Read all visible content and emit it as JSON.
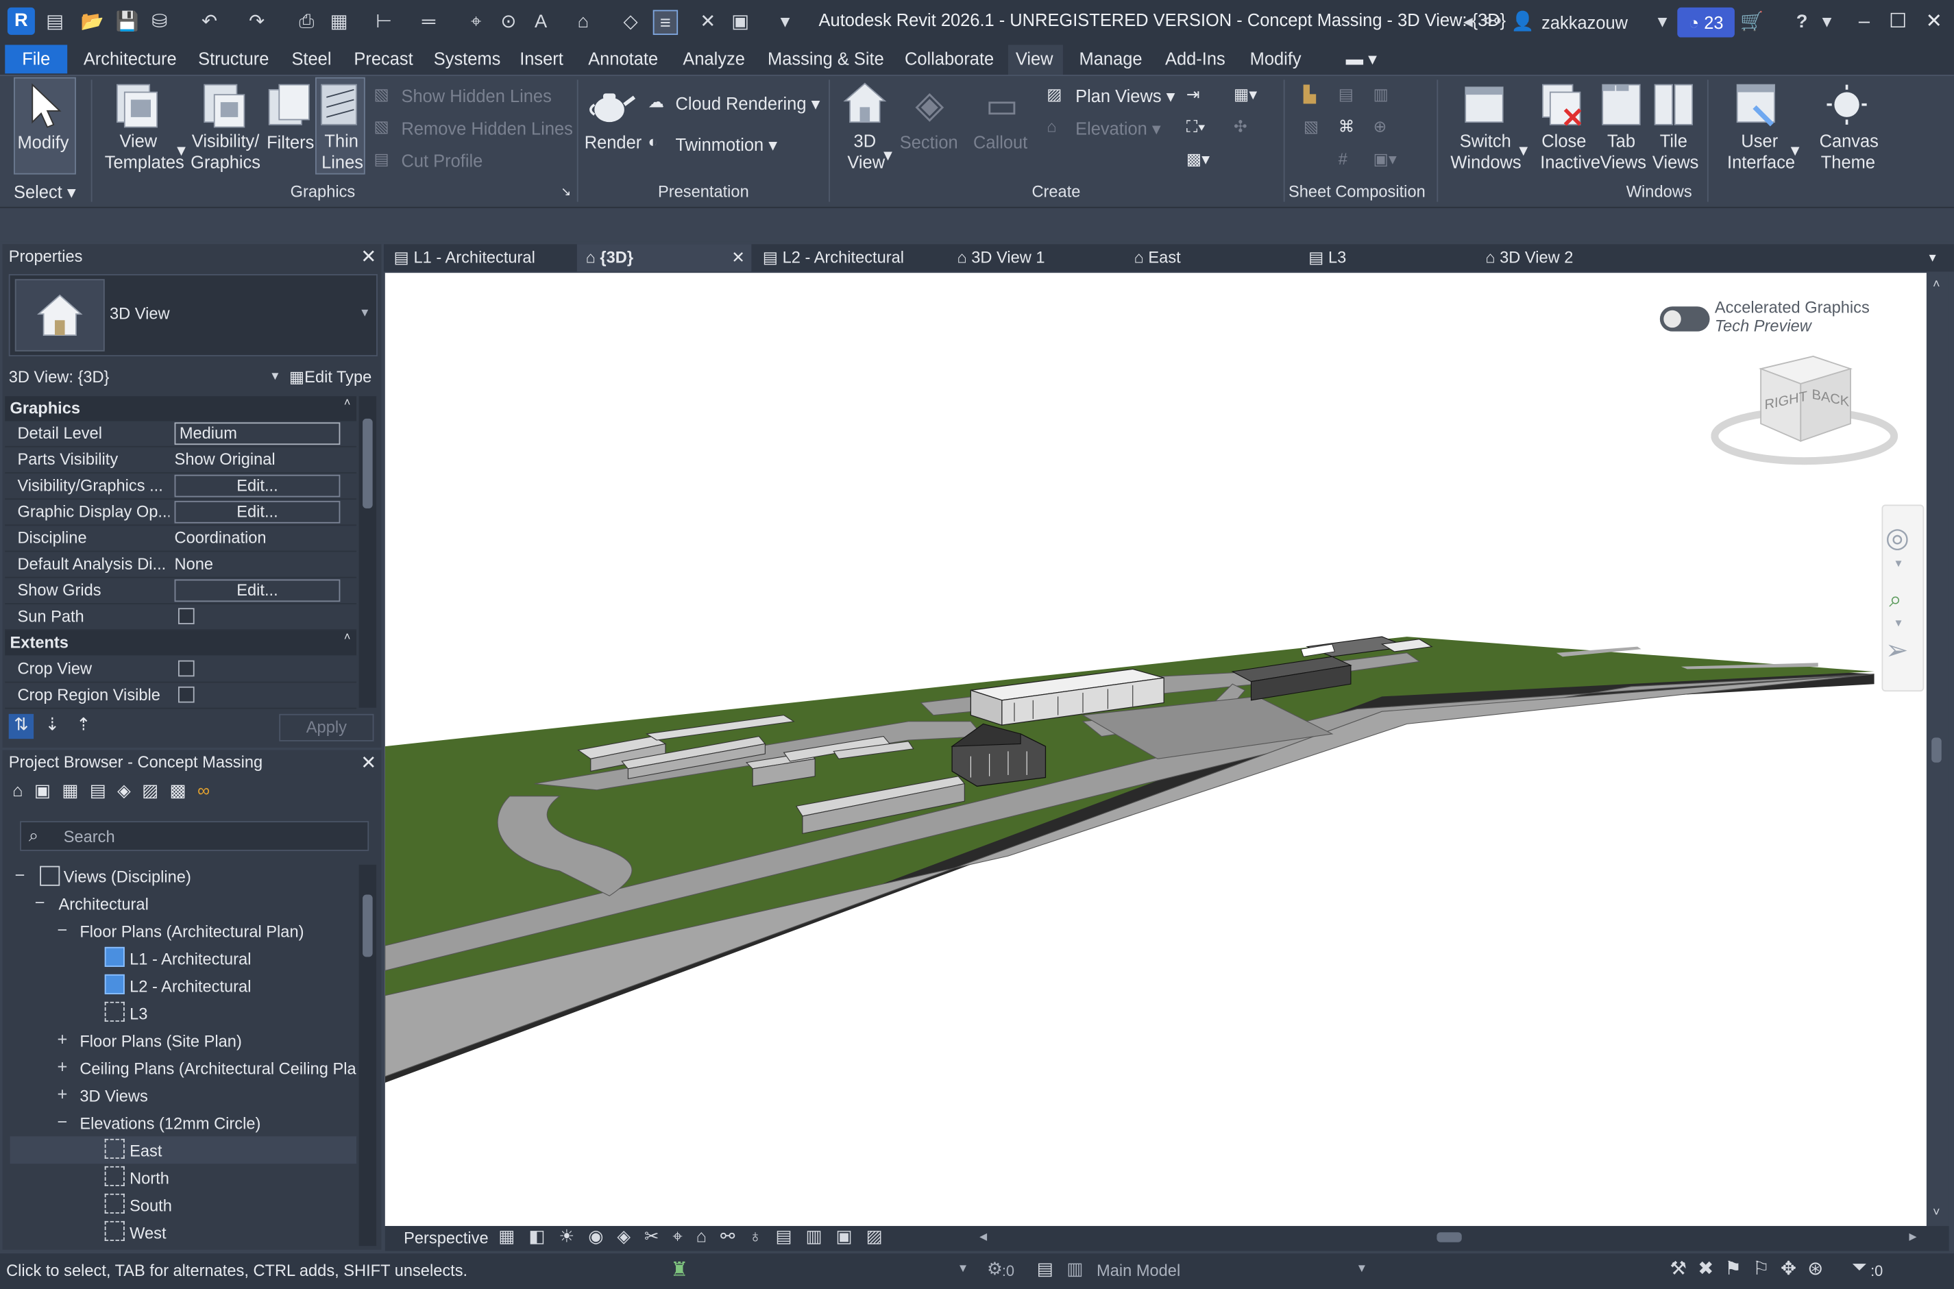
{
  "titlebar": {
    "title": "Autodesk Revit 2026.1 - UNREGISTERED VERSION - Concept Massing - 3D View: {3D}",
    "logo": "R",
    "user": "zakkazouw",
    "trial_count": "23"
  },
  "menu": {
    "file": "File",
    "items": [
      "Architecture",
      "Structure",
      "Steel",
      "Precast",
      "Systems",
      "Insert",
      "Annotate",
      "Analyze",
      "Massing & Site",
      "Collaborate",
      "View",
      "Manage",
      "Add-Ins",
      "Modify"
    ],
    "active": "View"
  },
  "ribbon": {
    "modify": "Modify",
    "select": "Select",
    "view_templates": [
      "View",
      "Templates"
    ],
    "vis_graphics": [
      "Visibility/",
      "Graphics"
    ],
    "filters": "Filters",
    "thin_lines": [
      "Thin",
      "Lines"
    ],
    "show_hidden": "Show  Hidden Lines",
    "remove_hidden": "Remove  Hidden Lines",
    "cut_profile": "Cut  Profile",
    "graphics_panel": "Graphics",
    "render": "Render",
    "cloud_rendering": "Cloud  Rendering",
    "twinmotion": "Twinmotion",
    "presentation_panel": "Presentation",
    "view3d": [
      "3D",
      "View"
    ],
    "section": "Section",
    "callout": "Callout",
    "plan_views": "Plan  Views",
    "elevation": "Elevation",
    "create_panel": "Create",
    "sheet_panel": "Sheet Composition",
    "switch_windows": [
      "Switch",
      "Windows"
    ],
    "close_inactive": [
      "Close",
      "Inactive"
    ],
    "tab_views": [
      "Tab",
      "Views"
    ],
    "tile_views": [
      "Tile",
      "Views"
    ],
    "user_interface": [
      "User",
      "Interface"
    ],
    "canvas_theme": [
      "Canvas",
      "Theme"
    ],
    "windows_panel": "Windows"
  },
  "properties": {
    "title": "Properties",
    "type_name": "3D View",
    "selector": "3D View: {3D}",
    "edit_type": "Edit Type",
    "cat_graphics": "Graphics",
    "rows": [
      {
        "name": "Detail Level",
        "value": "Medium",
        "kind": "field"
      },
      {
        "name": "Parts Visibility",
        "value": "Show Original",
        "kind": "text"
      },
      {
        "name": "Visibility/Graphics ...",
        "value": "Edit...",
        "kind": "button"
      },
      {
        "name": "Graphic Display Op...",
        "value": "Edit...",
        "kind": "button"
      },
      {
        "name": "Discipline",
        "value": "Coordination",
        "kind": "text"
      },
      {
        "name": "Default Analysis Di...",
        "value": "None",
        "kind": "text"
      },
      {
        "name": "Show Grids",
        "value": "Edit...",
        "kind": "button"
      },
      {
        "name": "Sun Path",
        "value": "",
        "kind": "check"
      }
    ],
    "cat_extents": "Extents",
    "extent_rows": [
      {
        "name": "Crop View",
        "value": "",
        "kind": "check"
      },
      {
        "name": "Crop Region Visible",
        "value": "",
        "kind": "check"
      }
    ],
    "apply": "Apply"
  },
  "browser": {
    "title": "Project Browser - Concept Massing",
    "search_placeholder": "Search",
    "root": "Views (Discipline)",
    "architectural": "Architectural",
    "floor_plans": "Floor Plans (Architectural Plan)",
    "l1": "L1 - Architectural",
    "l2": "L2 - Architectural",
    "l3": "L3",
    "site_plan": "Floor Plans (Site Plan)",
    "ceiling": "Ceiling Plans (Architectural Ceiling Pla",
    "views3d": "3D Views",
    "elevations": "Elevations (12mm Circle)",
    "east": "East",
    "north": "North",
    "south": "South",
    "west": "West"
  },
  "tabs": [
    "L1 - Architectural",
    "{3D}",
    "L2 - Architectural",
    "3D View 1",
    "East",
    "L3",
    "3D View 2"
  ],
  "canvas": {
    "accel_title": "Accelerated Graphics",
    "accel_sub": "Tech Preview",
    "cube_right": "RIGHT",
    "cube_back": "BACK",
    "colors": {
      "grass": "#4a6b2a",
      "pavement": "#9c9c9c",
      "ground_edge": "#2a2a2a"
    }
  },
  "viewbar": {
    "mode": "Perspective"
  },
  "status": {
    "hint": "Click to select, TAB for alternates, CTRL adds, SHIFT unselects.",
    "count_a": ":0",
    "model": "Main Model",
    "count_b": ":0"
  }
}
